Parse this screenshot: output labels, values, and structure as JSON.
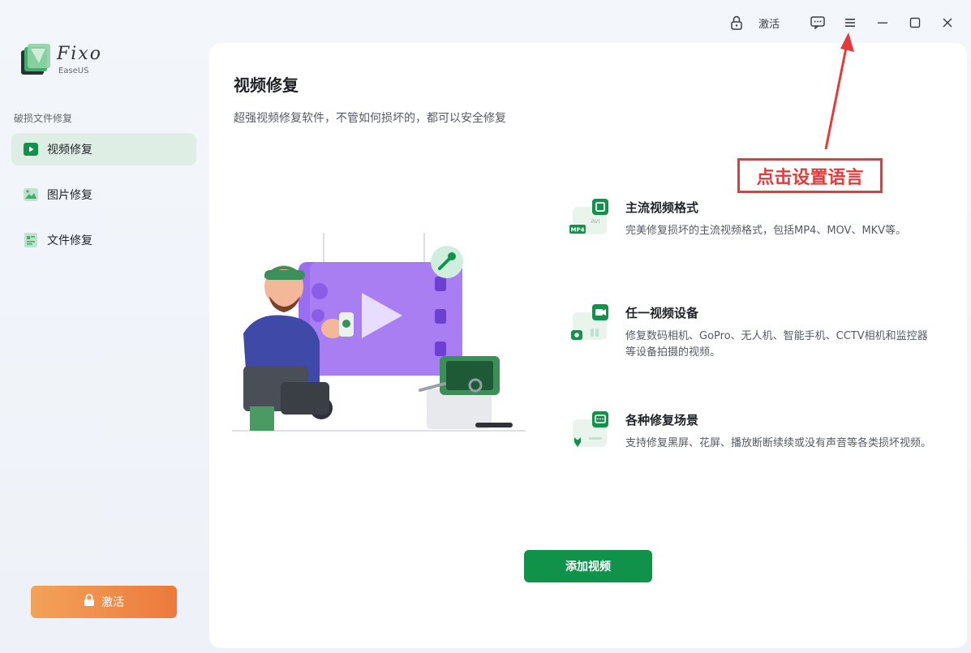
{
  "titlebar": {
    "activate_label": "激活",
    "icons": [
      "lock-icon",
      "feedback-icon",
      "menu-icon",
      "minimize-icon",
      "maximize-icon",
      "close-icon"
    ]
  },
  "sidebar": {
    "logo_name": "Fixo",
    "logo_sub": "EaseUS",
    "section_label": "破损文件修复",
    "items": [
      {
        "label": "视频修复",
        "icon": "video-play-icon",
        "active": true
      },
      {
        "label": "图片修复",
        "icon": "image-icon",
        "active": false
      },
      {
        "label": "文件修复",
        "icon": "document-icon",
        "active": false
      }
    ],
    "activate_label": "激活"
  },
  "main": {
    "title": "视频修复",
    "subtitle": "超强视频修复软件，不管如何损坏的，都可以安全修复",
    "features": [
      {
        "title": "主流视频格式",
        "desc": "完美修复损坏的主流视频格式，包括MP4、MOV、MKV等。",
        "badge": "MP4",
        "badge2": "AVI"
      },
      {
        "title": "任一视频设备",
        "desc": "修复数码相机、GoPro、无人机、智能手机、CCTV相机和监控器等设备拍摄的视频。"
      },
      {
        "title": "各种修复场景",
        "desc": "支持修复黑屏、花屏、播放断断续续或没有声音等各类损坏视频。"
      }
    ],
    "add_button": "添加视频"
  },
  "annotation": {
    "text": "点击设置语言"
  },
  "colors": {
    "accent": "#11924b",
    "activate_gradient_start": "#f3a25a",
    "activate_gradient_end": "#ec7a3c",
    "annotation_red": "#e23b3b"
  }
}
